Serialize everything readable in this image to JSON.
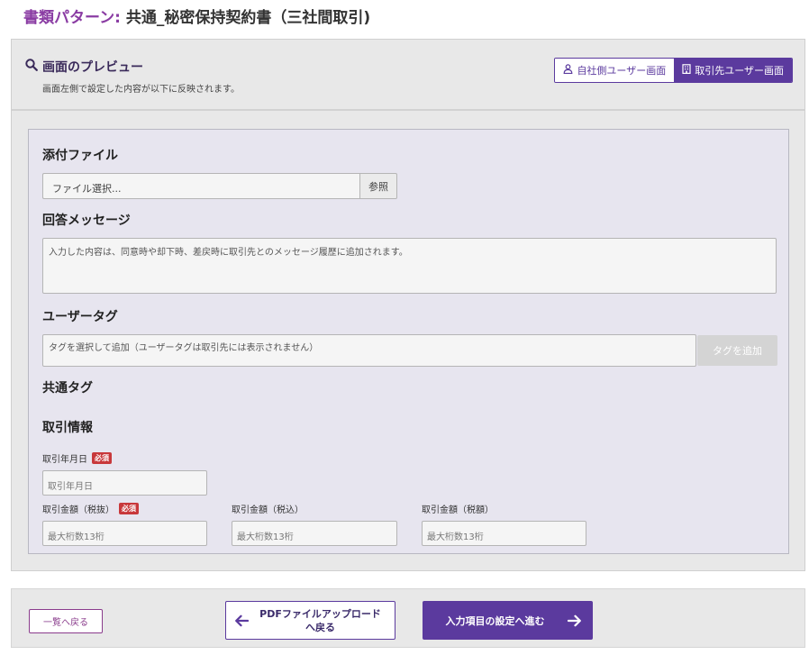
{
  "header": {
    "label": "書類パターン:",
    "title": "共通_秘密保持契約書（三社間取引)"
  },
  "preview": {
    "title": "画面のプレビュー",
    "subtitle": "画面左側で設定した内容が以下に反映されます。",
    "toggle_own": "自社側ユーザー画面",
    "toggle_partner": "取引先ユーザー画面"
  },
  "form": {
    "attachment_heading": "添付ファイル",
    "file_placeholder": "ファイル選択...",
    "browse_button": "参照",
    "message_heading": "回答メッセージ",
    "message_placeholder": "入力した内容は、同意時や却下時、差戻時に取引先とのメッセージ履歴に追加されます。",
    "user_tag_heading": "ユーザータグ",
    "user_tag_placeholder": "タグを選択して追加（ユーザータグは取引先には表示されません）",
    "add_tag_button": "タグを追加",
    "common_tag_heading": "共通タグ",
    "deal_info_heading": "取引情報",
    "required_badge": "必須",
    "date_label": "取引年月日",
    "date_placeholder": "取引年月日",
    "amount_ex_label": "取引金額（税抜）",
    "amount_in_label": "取引金額（税込）",
    "amount_tax_label": "取引金額（税額）",
    "amount_placeholder": "最大桁数13桁"
  },
  "footer": {
    "back_list": "一覧へ戻る",
    "back_pdf_line1": "PDFファイルアップロード",
    "back_pdf_line2": "へ戻る",
    "next": "入力項目の設定へ進む"
  },
  "colors": {
    "accent": "#5b3a9e",
    "title_label": "#8a3ca3",
    "required": "#c8383b"
  }
}
